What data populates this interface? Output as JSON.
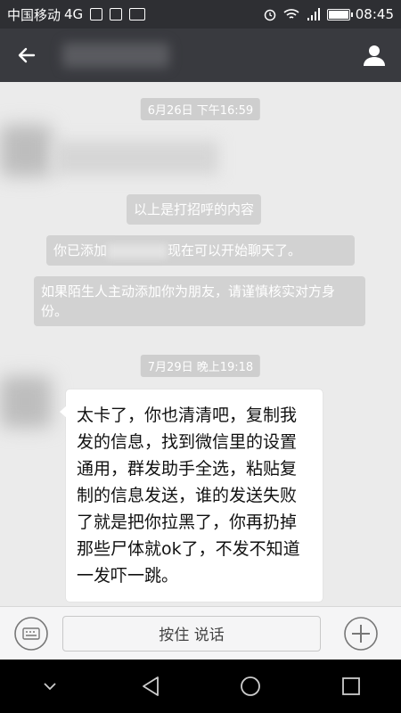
{
  "status_bar": {
    "carrier": "中国移动",
    "network": "4G",
    "time": "08:45"
  },
  "chat": {
    "time_divider_1": "6月26日 下午16:59",
    "system_greeting": "以上是打招呼的内容",
    "system_added_prefix": "你已添加",
    "system_added_suffix": "现在可以开始聊天了。",
    "system_warning": "如果陌生人主动添加你为朋友，请谨慎核实对方身份。",
    "time_divider_2": "7月29日 晚上19:18",
    "message": "太卡了，你也清清吧，复制我发的信息，找到微信里的设置通用，群发助手全选，粘贴复制的信息发送，谁的发送失败了就是把你拉黑了，你再扔掉那些尸体就ok了，不发不知道一发吓一跳。"
  },
  "input_bar": {
    "voice_label": "按住 说话"
  },
  "icons": {
    "back": "back-arrow-icon",
    "profile": "person-icon",
    "keyboard": "keyboard-icon",
    "plus": "plus-circle-icon",
    "nav_down": "chevron-down-icon",
    "nav_back": "triangle-back-icon",
    "nav_home": "circle-home-icon",
    "nav_recent": "square-recent-icon"
  },
  "colors": {
    "titlebar": "#393a3f",
    "statusbar": "#2e2f33",
    "chat_bg": "#ebebeb",
    "bubble": "#ffffff"
  }
}
